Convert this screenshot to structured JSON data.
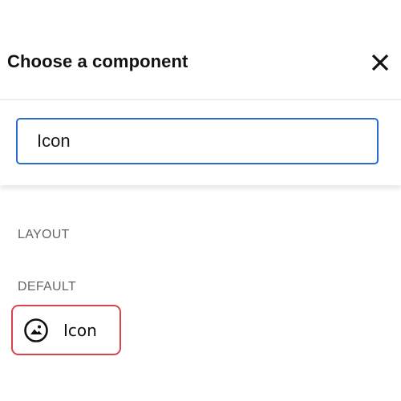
{
  "dialog": {
    "title": "Choose a component",
    "close_icon": "close-icon"
  },
  "search": {
    "value": "Icon",
    "placeholder": ""
  },
  "sections": {
    "layout_label": "LAYOUT",
    "default_label": "DEFAULT"
  },
  "components": {
    "items": [
      {
        "label": "Icon",
        "icon": "image-icon"
      }
    ]
  },
  "colors": {
    "focus_border": "#2b6cd0",
    "highlight_border": "#d6454f",
    "section_label": "#666666",
    "text": "#111111"
  }
}
